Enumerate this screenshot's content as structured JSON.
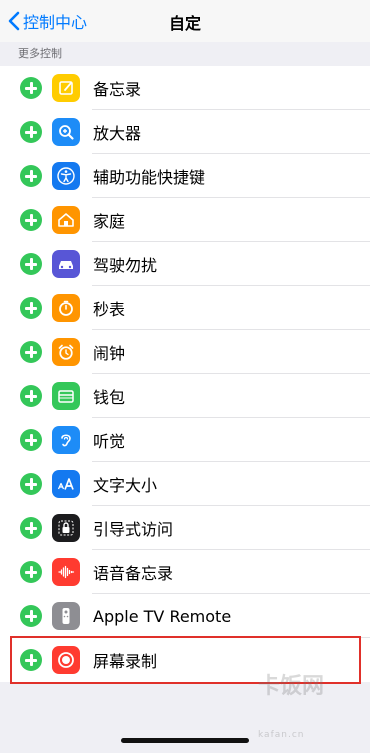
{
  "nav": {
    "back_label": "控制中心",
    "title": "自定"
  },
  "section": {
    "header": "更多控制"
  },
  "items": [
    {
      "label": "备忘录",
      "icon": "notes-icon",
      "color": "#ffcc00"
    },
    {
      "label": "放大器",
      "icon": "magnifier-icon",
      "color": "#1d8cf7"
    },
    {
      "label": "辅助功能快捷键",
      "icon": "accessibility-icon",
      "color": "#1479f0"
    },
    {
      "label": "家庭",
      "icon": "home-icon",
      "color": "#ff9500"
    },
    {
      "label": "驾驶勿扰",
      "icon": "car-icon",
      "color": "#5856d6"
    },
    {
      "label": "秒表",
      "icon": "stopwatch-icon",
      "color": "#ff9500"
    },
    {
      "label": "闹钟",
      "icon": "alarm-icon",
      "color": "#ff9500"
    },
    {
      "label": "钱包",
      "icon": "wallet-icon",
      "color": "#34c759"
    },
    {
      "label": "听觉",
      "icon": "ear-icon",
      "color": "#1d8cf7"
    },
    {
      "label": "文字大小",
      "icon": "text-size-icon",
      "color": "#1479f0"
    },
    {
      "label": "引导式访问",
      "icon": "lock-icon",
      "color": "#1c1c1e"
    },
    {
      "label": "语音备忘录",
      "icon": "voice-memo-icon",
      "color": "#ff3b30"
    },
    {
      "label": "Apple TV Remote",
      "icon": "tv-remote-icon",
      "color": "#8e8e93"
    },
    {
      "label": "屏幕录制",
      "icon": "screen-record-icon",
      "color": "#ff3b30"
    }
  ],
  "watermark": {
    "text": "卡饭网",
    "sub": "kafan.cn"
  }
}
